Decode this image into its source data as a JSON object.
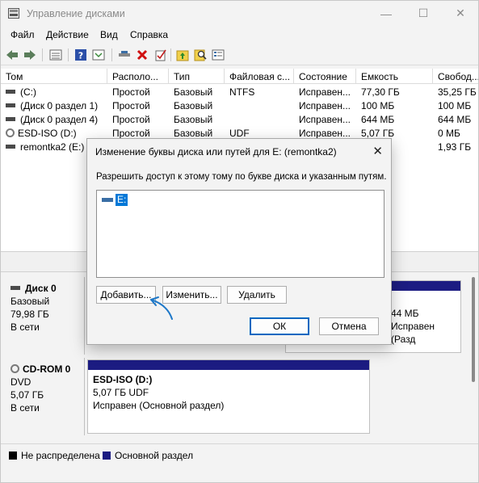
{
  "window": {
    "title": "Управление дисками",
    "minimize": "—",
    "maximize": "☐",
    "close": "✕"
  },
  "menu": [
    "Файл",
    "Действие",
    "Вид",
    "Справка"
  ],
  "toolbar_icons": [
    "back-icon",
    "forward-icon",
    "properties-icon",
    "help-icon",
    "refresh-icon",
    "connect-icon",
    "delete-icon",
    "check-icon",
    "up-folder-icon",
    "search-icon",
    "list-icon"
  ],
  "volume_table": {
    "columns": [
      "Том",
      "Располо...",
      "Тип",
      "Файловая с...",
      "Состояние",
      "Емкость",
      "Свобод..."
    ],
    "rows": [
      [
        "(C:)",
        "Простой",
        "Базовый",
        "NTFS",
        "Исправен...",
        "77,30 ГБ",
        "35,25 ГБ"
      ],
      [
        "(Диск 0 раздел 1)",
        "Простой",
        "Базовый",
        "",
        "Исправен...",
        "100 МБ",
        "100 МБ"
      ],
      [
        "(Диск 0 раздел 4)",
        "Простой",
        "Базовый",
        "",
        "Исправен...",
        "644 МБ",
        "644 МБ"
      ],
      [
        "ESD-ISO (D:)",
        "Простой",
        "Базовый",
        "UDF",
        "Исправен...",
        "5,07 ГБ",
        "0 МБ"
      ],
      [
        "remontka2 (E:)",
        "",
        "",
        "",
        "",
        "",
        "1,93 ГБ"
      ]
    ]
  },
  "disks": [
    {
      "name": "Диск 0",
      "type": "Базовый",
      "size": "79,98 ГБ",
      "status": "В сети",
      "partial_part": {
        "size": "44 МБ",
        "status": "Исправен (Разд"
      }
    },
    {
      "name": "CD-ROM 0",
      "type": "DVD",
      "size": "5,07 ГБ",
      "status": "В сети",
      "part": {
        "label": "ESD-ISO  (D:)",
        "size_fs": "5,07 ГБ UDF",
        "status": "Исправен (Основной раздел)"
      }
    }
  ],
  "legend": [
    {
      "label": "Не распределена",
      "color": "#000000"
    },
    {
      "label": "Основной раздел",
      "color": "#1c1c82"
    }
  ],
  "dialog": {
    "title": "Изменение буквы диска или путей для E: (remontka2)",
    "description": "Разрешить доступ к этому тому по букве диска и указанным путям.",
    "list_items": [
      "E:"
    ],
    "buttons": {
      "add": "Добавить...",
      "change": "Изменить...",
      "delete": "Удалить",
      "ok": "ОК",
      "cancel": "Отмена"
    }
  },
  "colors": {
    "accent": "#0067c0",
    "selection": "#0078d7",
    "primary_partition": "#1c1c82",
    "annotation_arrow": "#1e78c8"
  }
}
